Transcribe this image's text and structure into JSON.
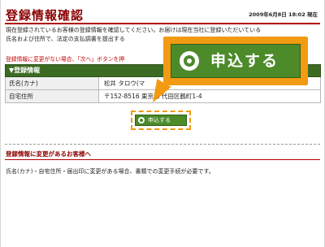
{
  "header": {
    "title": "登録情報確認",
    "datetime": "2009年6月8日 18:02 現在"
  },
  "intro": {
    "lines": [
      "現在登録されているお客様の登録情報を確認してください。お届けは現在当社に登録いただいている",
      "氏名および住所で、法定の支払調書を提出する"
    ],
    "note": "登録情報に変更がない場合、「次へ」ボタンを押"
  },
  "table": {
    "header": "▼登録情報",
    "rows": [
      {
        "label": "氏名(カナ)",
        "value": "松井 タロウ(マ"
      },
      {
        "label": "自宅住所",
        "value": "〒152-8516 東京都 代田区鶴町1-4"
      }
    ]
  },
  "buttons": {
    "apply_small": "申込する",
    "apply_large": "申込する"
  },
  "section2": {
    "title": "登録情報に変更があるお客様へ",
    "body": "氏名(カナ)・自宅住所・届出印に変更がある場合、書類での変更手続が必要です。"
  },
  "colors": {
    "accent_red": "#8b0000",
    "button_green": "#4c8a2a",
    "header_green": "#3c6b24",
    "callout_orange": "#f29a12"
  }
}
